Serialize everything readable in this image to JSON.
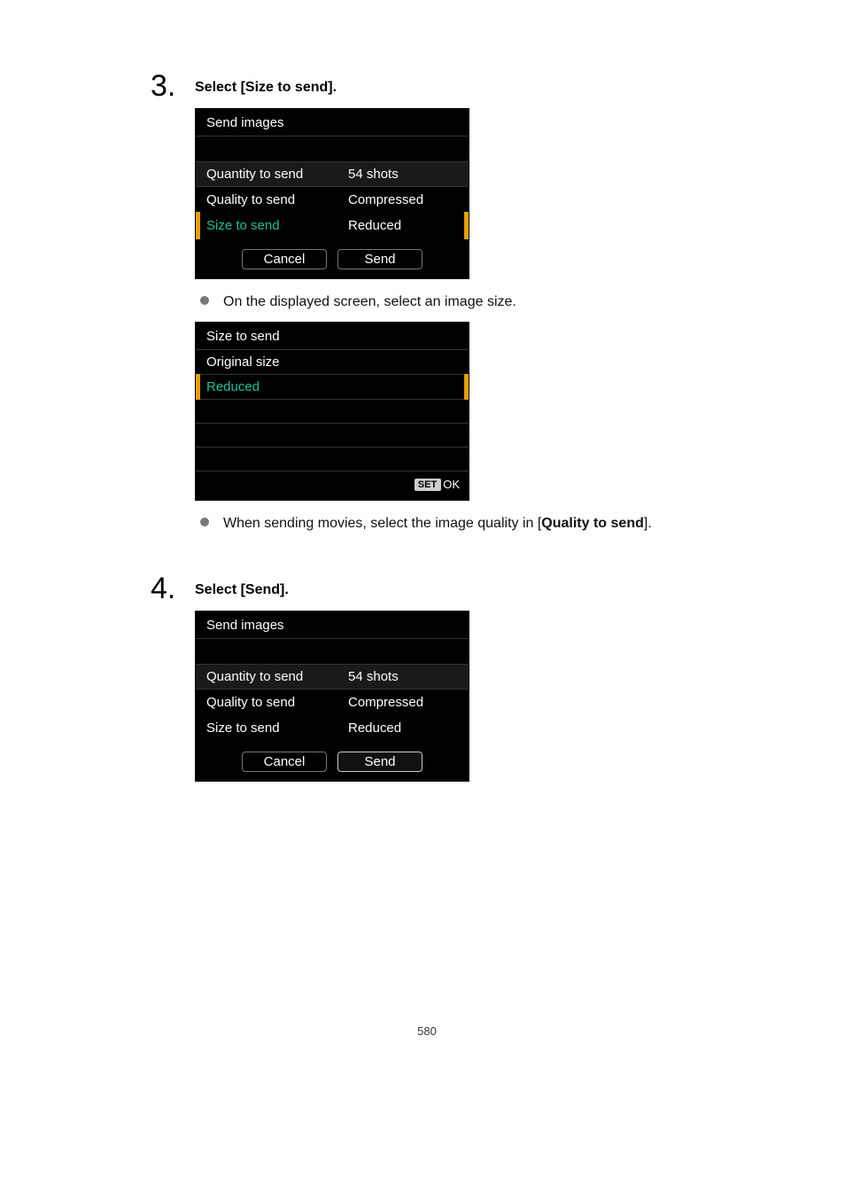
{
  "steps": [
    {
      "number": "3.",
      "heading": "Select [Size to send].",
      "screen1": {
        "title": "Send images",
        "quantity_label": "Quantity to send",
        "quantity_value": "54 shots",
        "quality_label": "Quality to send",
        "quality_value": "Compressed",
        "size_label": "Size to send",
        "size_value": "Reduced",
        "cancel": "Cancel",
        "send": "Send"
      },
      "note1": "On the displayed screen, select an image size.",
      "screen2": {
        "title": "Size to send",
        "option1": "Original size",
        "option2": "Reduced",
        "set_label": "SET",
        "ok_label": "OK"
      },
      "note2_prefix": "When sending movies, select the image quality in [",
      "note2_bold": "Quality to send",
      "note2_suffix": "]."
    },
    {
      "number": "4.",
      "heading": "Select [Send].",
      "screen1": {
        "title": "Send images",
        "quantity_label": "Quantity to send",
        "quantity_value": "54 shots",
        "quality_label": "Quality to send",
        "quality_value": "Compressed",
        "size_label": "Size to send",
        "size_value": "Reduced",
        "cancel": "Cancel",
        "send": "Send"
      }
    }
  ],
  "page_number": "580"
}
